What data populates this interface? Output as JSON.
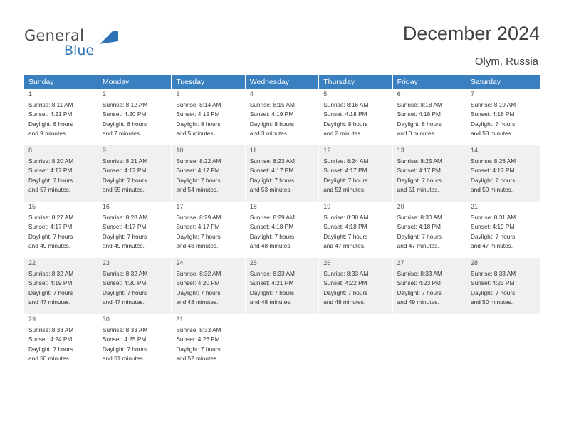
{
  "brand": {
    "name_top": "General",
    "name_bottom": "Blue",
    "accent_color": "#2e74b5",
    "logo_icon": "swoosh-icon"
  },
  "header": {
    "month_title": "December 2024",
    "location": "Olym, Russia"
  },
  "calendar": {
    "header_bg": "#3a80c1",
    "weekdays": [
      "Sunday",
      "Monday",
      "Tuesday",
      "Wednesday",
      "Thursday",
      "Friday",
      "Saturday"
    ],
    "weeks": [
      [
        {
          "day": "1",
          "sunrise": "Sunrise: 8:11 AM",
          "sunset": "Sunset: 4:21 PM",
          "daylight1": "Daylight: 8 hours",
          "daylight2": "and 9 minutes."
        },
        {
          "day": "2",
          "sunrise": "Sunrise: 8:12 AM",
          "sunset": "Sunset: 4:20 PM",
          "daylight1": "Daylight: 8 hours",
          "daylight2": "and 7 minutes."
        },
        {
          "day": "3",
          "sunrise": "Sunrise: 8:14 AM",
          "sunset": "Sunset: 4:19 PM",
          "daylight1": "Daylight: 8 hours",
          "daylight2": "and 5 minutes."
        },
        {
          "day": "4",
          "sunrise": "Sunrise: 8:15 AM",
          "sunset": "Sunset: 4:19 PM",
          "daylight1": "Daylight: 8 hours",
          "daylight2": "and 3 minutes."
        },
        {
          "day": "5",
          "sunrise": "Sunrise: 8:16 AM",
          "sunset": "Sunset: 4:18 PM",
          "daylight1": "Daylight: 8 hours",
          "daylight2": "and 2 minutes."
        },
        {
          "day": "6",
          "sunrise": "Sunrise: 8:18 AM",
          "sunset": "Sunset: 4:18 PM",
          "daylight1": "Daylight: 8 hours",
          "daylight2": "and 0 minutes."
        },
        {
          "day": "7",
          "sunrise": "Sunrise: 8:19 AM",
          "sunset": "Sunset: 4:18 PM",
          "daylight1": "Daylight: 7 hours",
          "daylight2": "and 58 minutes."
        }
      ],
      [
        {
          "day": "8",
          "sunrise": "Sunrise: 8:20 AM",
          "sunset": "Sunset: 4:17 PM",
          "daylight1": "Daylight: 7 hours",
          "daylight2": "and 57 minutes."
        },
        {
          "day": "9",
          "sunrise": "Sunrise: 8:21 AM",
          "sunset": "Sunset: 4:17 PM",
          "daylight1": "Daylight: 7 hours",
          "daylight2": "and 55 minutes."
        },
        {
          "day": "10",
          "sunrise": "Sunrise: 8:22 AM",
          "sunset": "Sunset: 4:17 PM",
          "daylight1": "Daylight: 7 hours",
          "daylight2": "and 54 minutes."
        },
        {
          "day": "11",
          "sunrise": "Sunrise: 8:23 AM",
          "sunset": "Sunset: 4:17 PM",
          "daylight1": "Daylight: 7 hours",
          "daylight2": "and 53 minutes."
        },
        {
          "day": "12",
          "sunrise": "Sunrise: 8:24 AM",
          "sunset": "Sunset: 4:17 PM",
          "daylight1": "Daylight: 7 hours",
          "daylight2": "and 52 minutes."
        },
        {
          "day": "13",
          "sunrise": "Sunrise: 8:25 AM",
          "sunset": "Sunset: 4:17 PM",
          "daylight1": "Daylight: 7 hours",
          "daylight2": "and 51 minutes."
        },
        {
          "day": "14",
          "sunrise": "Sunrise: 8:26 AM",
          "sunset": "Sunset: 4:17 PM",
          "daylight1": "Daylight: 7 hours",
          "daylight2": "and 50 minutes."
        }
      ],
      [
        {
          "day": "15",
          "sunrise": "Sunrise: 8:27 AM",
          "sunset": "Sunset: 4:17 PM",
          "daylight1": "Daylight: 7 hours",
          "daylight2": "and 49 minutes."
        },
        {
          "day": "16",
          "sunrise": "Sunrise: 8:28 AM",
          "sunset": "Sunset: 4:17 PM",
          "daylight1": "Daylight: 7 hours",
          "daylight2": "and 49 minutes."
        },
        {
          "day": "17",
          "sunrise": "Sunrise: 8:29 AM",
          "sunset": "Sunset: 4:17 PM",
          "daylight1": "Daylight: 7 hours",
          "daylight2": "and 48 minutes."
        },
        {
          "day": "18",
          "sunrise": "Sunrise: 8:29 AM",
          "sunset": "Sunset: 4:18 PM",
          "daylight1": "Daylight: 7 hours",
          "daylight2": "and 48 minutes."
        },
        {
          "day": "19",
          "sunrise": "Sunrise: 8:30 AM",
          "sunset": "Sunset: 4:18 PM",
          "daylight1": "Daylight: 7 hours",
          "daylight2": "and 47 minutes."
        },
        {
          "day": "20",
          "sunrise": "Sunrise: 8:30 AM",
          "sunset": "Sunset: 4:18 PM",
          "daylight1": "Daylight: 7 hours",
          "daylight2": "and 47 minutes."
        },
        {
          "day": "21",
          "sunrise": "Sunrise: 8:31 AM",
          "sunset": "Sunset: 4:19 PM",
          "daylight1": "Daylight: 7 hours",
          "daylight2": "and 47 minutes."
        }
      ],
      [
        {
          "day": "22",
          "sunrise": "Sunrise: 8:32 AM",
          "sunset": "Sunset: 4:19 PM",
          "daylight1": "Daylight: 7 hours",
          "daylight2": "and 47 minutes."
        },
        {
          "day": "23",
          "sunrise": "Sunrise: 8:32 AM",
          "sunset": "Sunset: 4:20 PM",
          "daylight1": "Daylight: 7 hours",
          "daylight2": "and 47 minutes."
        },
        {
          "day": "24",
          "sunrise": "Sunrise: 8:32 AM",
          "sunset": "Sunset: 4:20 PM",
          "daylight1": "Daylight: 7 hours",
          "daylight2": "and 48 minutes."
        },
        {
          "day": "25",
          "sunrise": "Sunrise: 8:33 AM",
          "sunset": "Sunset: 4:21 PM",
          "daylight1": "Daylight: 7 hours",
          "daylight2": "and 48 minutes."
        },
        {
          "day": "26",
          "sunrise": "Sunrise: 8:33 AM",
          "sunset": "Sunset: 4:22 PM",
          "daylight1": "Daylight: 7 hours",
          "daylight2": "and 48 minutes."
        },
        {
          "day": "27",
          "sunrise": "Sunrise: 8:33 AM",
          "sunset": "Sunset: 4:23 PM",
          "daylight1": "Daylight: 7 hours",
          "daylight2": "and 49 minutes."
        },
        {
          "day": "28",
          "sunrise": "Sunrise: 8:33 AM",
          "sunset": "Sunset: 4:23 PM",
          "daylight1": "Daylight: 7 hours",
          "daylight2": "and 50 minutes."
        }
      ],
      [
        {
          "day": "29",
          "sunrise": "Sunrise: 8:33 AM",
          "sunset": "Sunset: 4:24 PM",
          "daylight1": "Daylight: 7 hours",
          "daylight2": "and 50 minutes."
        },
        {
          "day": "30",
          "sunrise": "Sunrise: 8:33 AM",
          "sunset": "Sunset: 4:25 PM",
          "daylight1": "Daylight: 7 hours",
          "daylight2": "and 51 minutes."
        },
        {
          "day": "31",
          "sunrise": "Sunrise: 8:33 AM",
          "sunset": "Sunset: 4:26 PM",
          "daylight1": "Daylight: 7 hours",
          "daylight2": "and 52 minutes."
        },
        {
          "day": "",
          "sunrise": "",
          "sunset": "",
          "daylight1": "",
          "daylight2": ""
        },
        {
          "day": "",
          "sunrise": "",
          "sunset": "",
          "daylight1": "",
          "daylight2": ""
        },
        {
          "day": "",
          "sunrise": "",
          "sunset": "",
          "daylight1": "",
          "daylight2": ""
        },
        {
          "day": "",
          "sunrise": "",
          "sunset": "",
          "daylight1": "",
          "daylight2": ""
        }
      ]
    ]
  }
}
